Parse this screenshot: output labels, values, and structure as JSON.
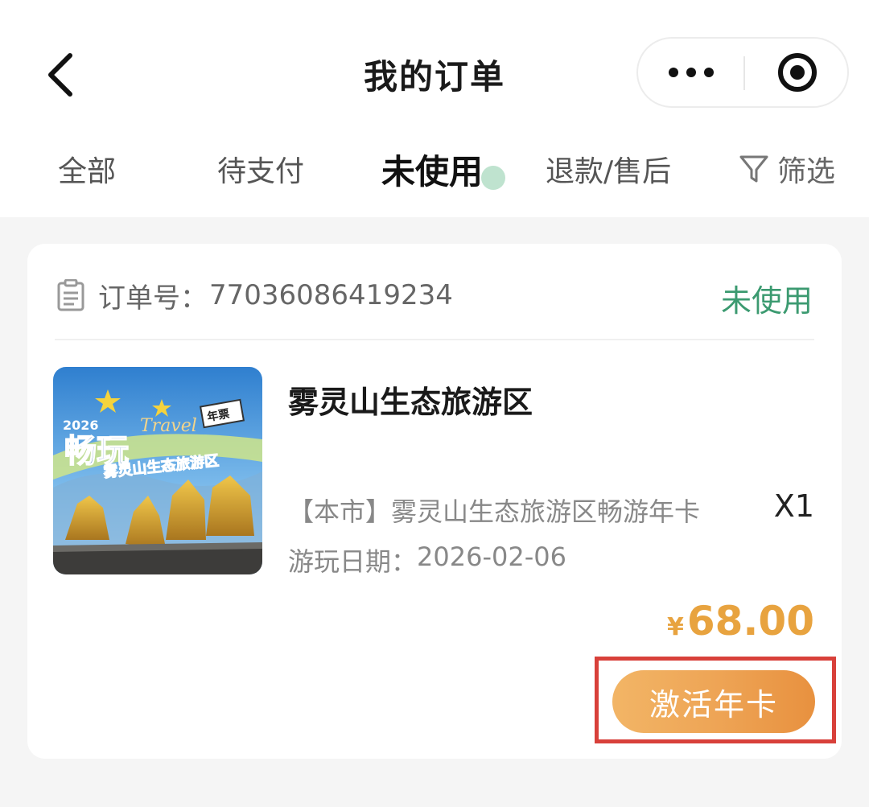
{
  "header": {
    "title": "我的订单",
    "back_icon": "chevron-left-icon",
    "more_icon": "more-dots-icon",
    "close_icon": "target-circle-icon"
  },
  "tabs": [
    {
      "label": "全部",
      "active": false
    },
    {
      "label": "待支付",
      "active": false
    },
    {
      "label": "未使用",
      "active": true
    },
    {
      "label": "退款/售后",
      "active": false
    }
  ],
  "filter": {
    "label": "筛选",
    "icon": "funnel-icon"
  },
  "order": {
    "label": "订单号：",
    "number": "77036086419234",
    "status": "未使用",
    "status_color": "#3b9a70",
    "product_name": "雾灵山生态旅游区",
    "description": "【本市】雾灵山生态旅游区畅游年卡",
    "quantity": "X1",
    "play_date_label": "游玩日期：",
    "play_date": "2026-02-06",
    "price_currency": "¥",
    "price": "68.00",
    "price_color": "#e8a33f",
    "action_button": "激活年卡",
    "thumbnail": {
      "year": "2026",
      "title_left": "畅玩",
      "title_right": "年票",
      "script": "Travel",
      "banner": "雾灵山生态旅游区"
    }
  }
}
